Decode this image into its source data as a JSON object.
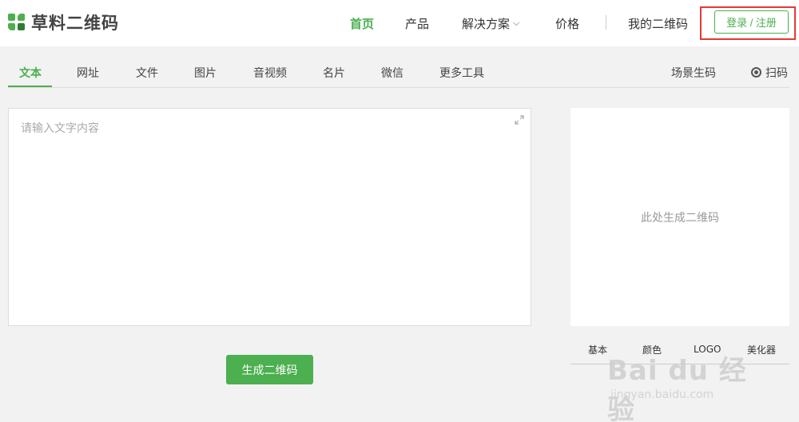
{
  "header": {
    "logo_text": "草料二维码",
    "nav": {
      "home": "首页",
      "products": "产品",
      "solutions": "解决方案",
      "price": "价格",
      "my_qr": "我的二维码"
    },
    "login_label": "登录 / 注册"
  },
  "tabs": {
    "items": [
      "文本",
      "网址",
      "文件",
      "图片",
      "音视频",
      "名片",
      "微信",
      "更多工具"
    ],
    "active": "文本",
    "scene": "场景生码",
    "scan": "扫码"
  },
  "editor": {
    "placeholder": "请输入文字内容",
    "value": "",
    "generate_label": "生成二维码"
  },
  "preview": {
    "placeholder": "此处生成二维码",
    "settings_tabs": [
      "基本",
      "颜色",
      "LOGO",
      "美化器"
    ]
  },
  "watermark": {
    "main": "Bai du 经验",
    "sub": "jingyan.baidu.com"
  },
  "colors": {
    "accent": "#4caf50",
    "highlight": "#e53935"
  }
}
